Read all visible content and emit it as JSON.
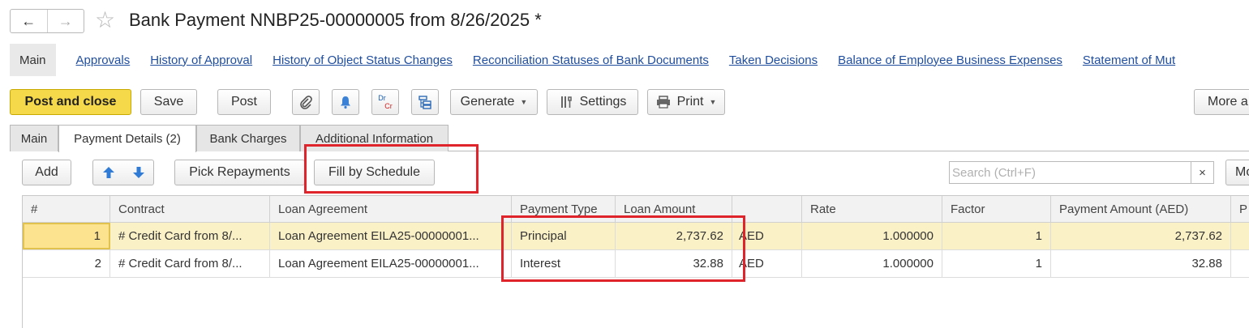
{
  "window": {
    "title": "Bank Payment NNBP25-00000005 from 8/26/2025 *"
  },
  "nav": {
    "back_icon": "←",
    "forward_icon": "→",
    "favorite_icon": "☆"
  },
  "linkbar": {
    "main": "Main",
    "links": [
      "Approvals",
      "History of Approval",
      "History of Object Status Changes",
      "Reconciliation Statuses of Bank Documents",
      "Taken Decisions",
      "Balance of Employee Business Expenses",
      "Statement of Mut"
    ]
  },
  "toolbar": {
    "post_and_close": "Post and close",
    "save": "Save",
    "post": "Post",
    "drcr_top": "Dr",
    "drcr_bottom": "Cr",
    "generate": "Generate",
    "settings": "Settings",
    "print": "Print",
    "more": "More a"
  },
  "tabs": [
    "Main",
    "Payment Details (2)",
    "Bank Charges",
    "Additional Information"
  ],
  "table_toolbar": {
    "add": "Add",
    "pick_repayments": "Pick Repayments",
    "fill_by_schedule": "Fill by Schedule",
    "search_placeholder": "Search (Ctrl+F)",
    "clear": "×",
    "more": "Mo"
  },
  "grid": {
    "columns": [
      "#",
      "Contract",
      "Loan Agreement",
      "Payment Type",
      "Loan Amount",
      "",
      "Rate",
      "Factor",
      "Payment Amount (AED)",
      "P"
    ],
    "rows": [
      [
        "1",
        "# Credit Card from 8/...",
        "Loan Agreement EILA25-00000001...",
        "Principal",
        "2,737.62",
        "AED",
        "1.000000",
        "1",
        "2,737.62",
        ""
      ],
      [
        "2",
        "# Credit Card from 8/...",
        "Loan Agreement EILA25-00000001...",
        "Interest",
        "32.88",
        "AED",
        "1.000000",
        "1",
        "32.88",
        ""
      ]
    ]
  },
  "colors": {
    "accent_primary": "#f5d94a",
    "selected_row": "#fbf1c7",
    "annotation": "#e0242b",
    "link": "#1f4d9e"
  }
}
